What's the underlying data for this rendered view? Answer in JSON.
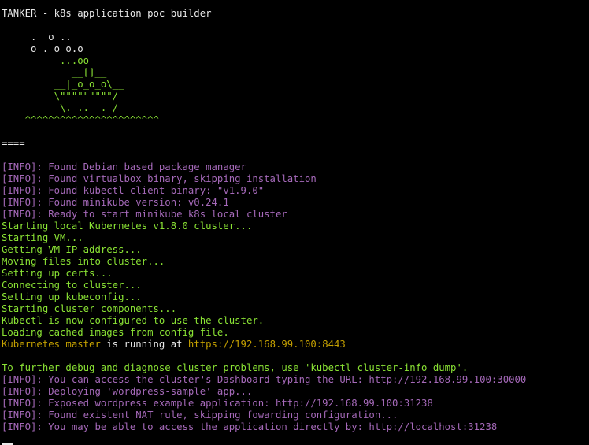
{
  "terminal": {
    "title": "TANKER - k8s application poc builder",
    "logo": [
      "     .  o ..",
      "     o . o o.o",
      "          ...oo",
      "            __[]__",
      "         __|_o_o_o\\__",
      "         \\\"\"\"\"\"\"\"\"\"/",
      "          \\. ..  . /",
      "    ^^^^^^^^^^^^^^^^^^^^^^^"
    ],
    "separator": "====",
    "info_lines": [
      "[INFO]: Found Debian based package manager",
      "[INFO]: Found virtualbox binary, skipping installation",
      "[INFO]: Found kubectl client-binary: \"v1.9.0\"",
      "[INFO]: Found minikube version: v0.24.1",
      "[INFO]: Ready to start minikube k8s local cluster"
    ],
    "output_lines": [
      "Starting local Kubernetes v1.8.0 cluster...",
      "Starting VM...",
      "Getting VM IP address...",
      "Moving files into cluster...",
      "Setting up certs...",
      "Connecting to cluster...",
      "Setting up kubeconfig...",
      "Starting cluster components...",
      "Kubectl is now configured to use the cluster.",
      "Loading cached images from config file."
    ],
    "master_line": {
      "prefix": "Kubernetes master",
      "middle": " is running at ",
      "url": "https://192.168.99.100:8443"
    },
    "debug_line": "To further debug and diagnose cluster problems, use 'kubectl cluster-info dump'.",
    "final_info_lines": [
      "[INFO]: You can access the cluster's Dashboard typing the URL: http://192.168.99.100:30000",
      "[INFO]: Deploying 'wordpress-sample' app...",
      "[INFO]: Exposed wordpress example application: http://192.168.99.100:31238",
      "[INFO]: Found existent NAT rule, skipping fowarding configuration...",
      "[INFO]: You may be able to access the application directly by: http://localhost:31238"
    ],
    "colors": {
      "background": "#000000",
      "default_text": "#e8e8e8",
      "green": "#8ae234",
      "info_magenta": "#a569b9",
      "url_yellow": "#c4a000"
    }
  }
}
